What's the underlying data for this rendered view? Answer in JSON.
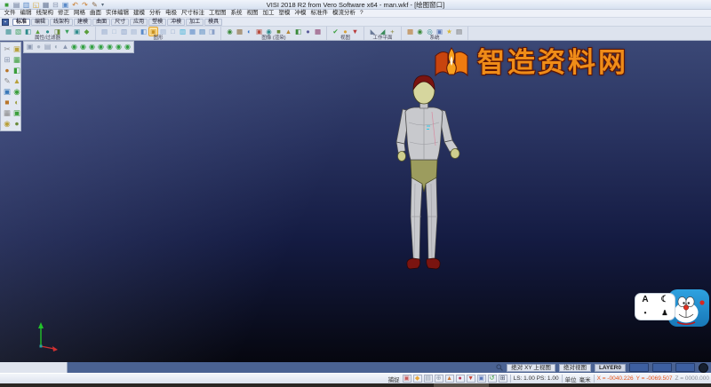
{
  "window": {
    "title": "VISI 2018 R2 from Vero Software x64 - man.wkf - [绘图窗口]"
  },
  "quick_access": {
    "more": "▾",
    "icons": [
      {
        "g": "■",
        "c": "#3a9e3a"
      },
      {
        "g": "▤",
        "c": "#6a7a98"
      },
      {
        "g": "▥",
        "c": "#5a8ac8"
      },
      {
        "g": "◱",
        "c": "#d8a83a"
      },
      {
        "g": "▦",
        "c": "#6a7a98"
      },
      {
        "g": "⊟",
        "c": "#8a97b0"
      },
      {
        "g": "▣",
        "c": "#5a8ac8"
      },
      {
        "g": "↶",
        "c": "#c87a2a"
      },
      {
        "g": "↷",
        "c": "#c87a2a"
      },
      {
        "g": "✎",
        "c": "#8a6a4a"
      }
    ]
  },
  "menubar": {
    "items": [
      "文件",
      "编辑",
      "线架构",
      "修正",
      "网格",
      "曲面",
      "实体编辑",
      "建模",
      "分析",
      "电极",
      "尺寸标注",
      "工程图",
      "系统",
      "视图",
      "加工",
      "塑模",
      "冲模",
      "标准件",
      "模流分析",
      "?"
    ]
  },
  "tabbar": {
    "lead": "▪",
    "items": [
      {
        "label": "标准",
        "cls": "selected"
      },
      {
        "label": "编辑"
      },
      {
        "label": "线架构"
      },
      {
        "label": "建模"
      },
      {
        "label": "曲面"
      },
      {
        "label": "尺寸"
      },
      {
        "label": "应用"
      },
      {
        "label": "塑模"
      },
      {
        "label": "冲模"
      },
      {
        "label": "加工"
      },
      {
        "label": "模具"
      }
    ]
  },
  "ribbon": {
    "groups": [
      {
        "label": "属性/过滤器",
        "icons": [
          {
            "g": "▦",
            "c": "#2e8b8b"
          },
          {
            "g": "▧",
            "c": "#3aa05a"
          },
          {
            "g": "◧",
            "c": "#2e8b8b"
          },
          {
            "g": "▲",
            "c": "#5a9e3a"
          },
          {
            "g": "●",
            "c": "#2e8b8b"
          },
          {
            "g": "◨",
            "c": "#6a8a3a"
          },
          {
            "g": "▼",
            "c": "#3aa05a"
          },
          {
            "g": "▣",
            "c": "#2e8b8b"
          },
          {
            "g": "◆",
            "c": "#5a9e3a"
          }
        ]
      },
      {
        "label": "图形",
        "icons": [
          {
            "g": "▤",
            "c": "#8aa0c8"
          },
          {
            "g": "□",
            "c": "#9ab0d0"
          },
          {
            "g": "▥",
            "c": "#8aa0c8"
          },
          {
            "g": "▤",
            "c": "#9ab0d0"
          },
          {
            "g": "◧",
            "c": "#5a8ac8"
          },
          {
            "g": "▣",
            "c": "#c89020",
            "cls": "hl"
          },
          {
            "g": "▤",
            "c": "#9ab0d0"
          },
          {
            "g": "□",
            "c": "#8aa0c8"
          },
          {
            "g": "▥",
            "c": "#3ab0d8"
          },
          {
            "g": "▦",
            "c": "#5a8ac8"
          },
          {
            "g": "▤",
            "c": "#3a78b8"
          },
          {
            "g": "◨",
            "c": "#8aa0c8"
          }
        ]
      },
      {
        "label": "图像 (渲染)",
        "icons": [
          {
            "g": "◉",
            "c": "#3a8a3a"
          },
          {
            "g": "▦",
            "c": "#8a6a3a"
          },
          {
            "g": "◐",
            "c": "#3a78c8"
          },
          {
            "g": "▣",
            "c": "#b84a3a"
          },
          {
            "g": "◉",
            "c": "#2e8b8b"
          },
          {
            "g": "■",
            "c": "#6a8a3a"
          },
          {
            "g": "▲",
            "c": "#b8883a"
          },
          {
            "g": "◧",
            "c": "#3a8a3a"
          },
          {
            "g": "●",
            "c": "#5a5a9a"
          },
          {
            "g": "▦",
            "c": "#8a3a6a"
          }
        ]
      },
      {
        "label": "视图",
        "icons": [
          {
            "g": "✔",
            "c": "#3a9e3a"
          },
          {
            "g": "●",
            "c": "#d8a23a"
          },
          {
            "g": "▼",
            "c": "#b83a3a"
          }
        ]
      },
      {
        "label": "工作平面",
        "icons": [
          {
            "g": "◣",
            "c": "#6a7a98"
          },
          {
            "g": "◢",
            "c": "#3a8a5a"
          },
          {
            "g": "+",
            "c": "#8a8a3a"
          }
        ]
      },
      {
        "label": "系统",
        "icons": [
          {
            "g": "▦",
            "c": "#b8762a"
          },
          {
            "g": "◉",
            "c": "#3a8a3a"
          },
          {
            "g": "◎",
            "c": "#2e8b8b"
          },
          {
            "g": "▣",
            "c": "#5a78b8"
          },
          {
            "g": "★",
            "c": "#d8b83a"
          },
          {
            "g": "▤",
            "c": "#6a6a6a"
          }
        ]
      }
    ]
  },
  "float_toolbar": {
    "icons": [
      {
        "g": "▣",
        "c": "#8a97b0"
      },
      {
        "g": "●",
        "c": "#aab4c4"
      },
      {
        "g": "▤",
        "c": "#8a97b0"
      },
      {
        "g": "◐",
        "c": "#9aa8b8"
      },
      {
        "g": "▲",
        "c": "#8a97b0"
      },
      {
        "g": "◉",
        "c": "#2f9e3e"
      },
      {
        "g": "◉",
        "c": "#2f9e3e"
      },
      {
        "g": "◉",
        "c": "#2f9e3e"
      },
      {
        "g": "◉",
        "c": "#2f9e3e"
      },
      {
        "g": "◉",
        "c": "#2f9e3e"
      },
      {
        "g": "◉",
        "c": "#2f9e3e"
      },
      {
        "g": "◉",
        "c": "#2f9e3e"
      }
    ]
  },
  "side_toolbar": {
    "icons": [
      {
        "g": "✂",
        "c": "#8a8a8a"
      },
      {
        "g": "▣",
        "c": "#b8a03a"
      },
      {
        "g": "⊞",
        "c": "#8a97b0"
      },
      {
        "g": "▦",
        "c": "#3a9e3a"
      },
      {
        "g": "●",
        "c": "#b8762a"
      },
      {
        "g": "◧",
        "c": "#3a9e3a"
      },
      {
        "g": "✎",
        "c": "#8a8a8a"
      },
      {
        "g": "▲",
        "c": "#b8a03a"
      },
      {
        "g": "▣",
        "c": "#3a78b8"
      },
      {
        "g": "◉",
        "c": "#3a9e3a"
      },
      {
        "g": "■",
        "c": "#b8762a"
      },
      {
        "g": "◐",
        "c": "#9a9a3a"
      },
      {
        "g": "▦",
        "c": "#8a8a8a"
      },
      {
        "g": "▣",
        "c": "#3a9e3a"
      },
      {
        "g": "◉",
        "c": "#b8a03a"
      },
      {
        "g": "●",
        "c": "#6a8a3a"
      }
    ]
  },
  "watermark": {
    "text": "智造资料网",
    "color": "#ef8c18"
  },
  "viewport": {
    "gradient_top": "#3b4876",
    "gradient_bottom": "#06070f"
  },
  "widget": {
    "letter": "A",
    "moon": "☾",
    "dot": "•",
    "figure": "♟"
  },
  "prompt_bar": {
    "view_mode": "绝对 XY 上视图",
    "view_name": "绝对视图",
    "layer": "LAYER0",
    "swatches": [
      "#3d5fa0",
      "#3d5fa0",
      "#3d5fa0"
    ]
  },
  "status_bar": {
    "snap_label": "捕捉",
    "icons": [
      {
        "g": "▣",
        "c": "#c85a5a"
      },
      {
        "g": "◆",
        "c": "#e8a83a"
      },
      {
        "g": "▤",
        "c": "#8a97a8"
      },
      {
        "g": "⊕",
        "c": "#8a97a8"
      },
      {
        "g": "▲",
        "c": "#c87a3a"
      },
      {
        "g": "●",
        "c": "#b83a5a"
      },
      {
        "g": "▼",
        "c": "#c8483a"
      },
      {
        "g": "▣",
        "c": "#5a78b8"
      },
      {
        "g": "↺",
        "c": "#3a9e3a"
      },
      {
        "g": "⊞",
        "c": "#44506a"
      }
    ],
    "scale": "LS: 1.00 PS: 1.00",
    "unit_label": "单位",
    "unit_value": "毫米",
    "coord_x": "X = -0040.226",
    "coord_y": "Y = -0069.507",
    "coord_z": "Z = 0000.000",
    "coord_xy_color": "#e8551a"
  }
}
